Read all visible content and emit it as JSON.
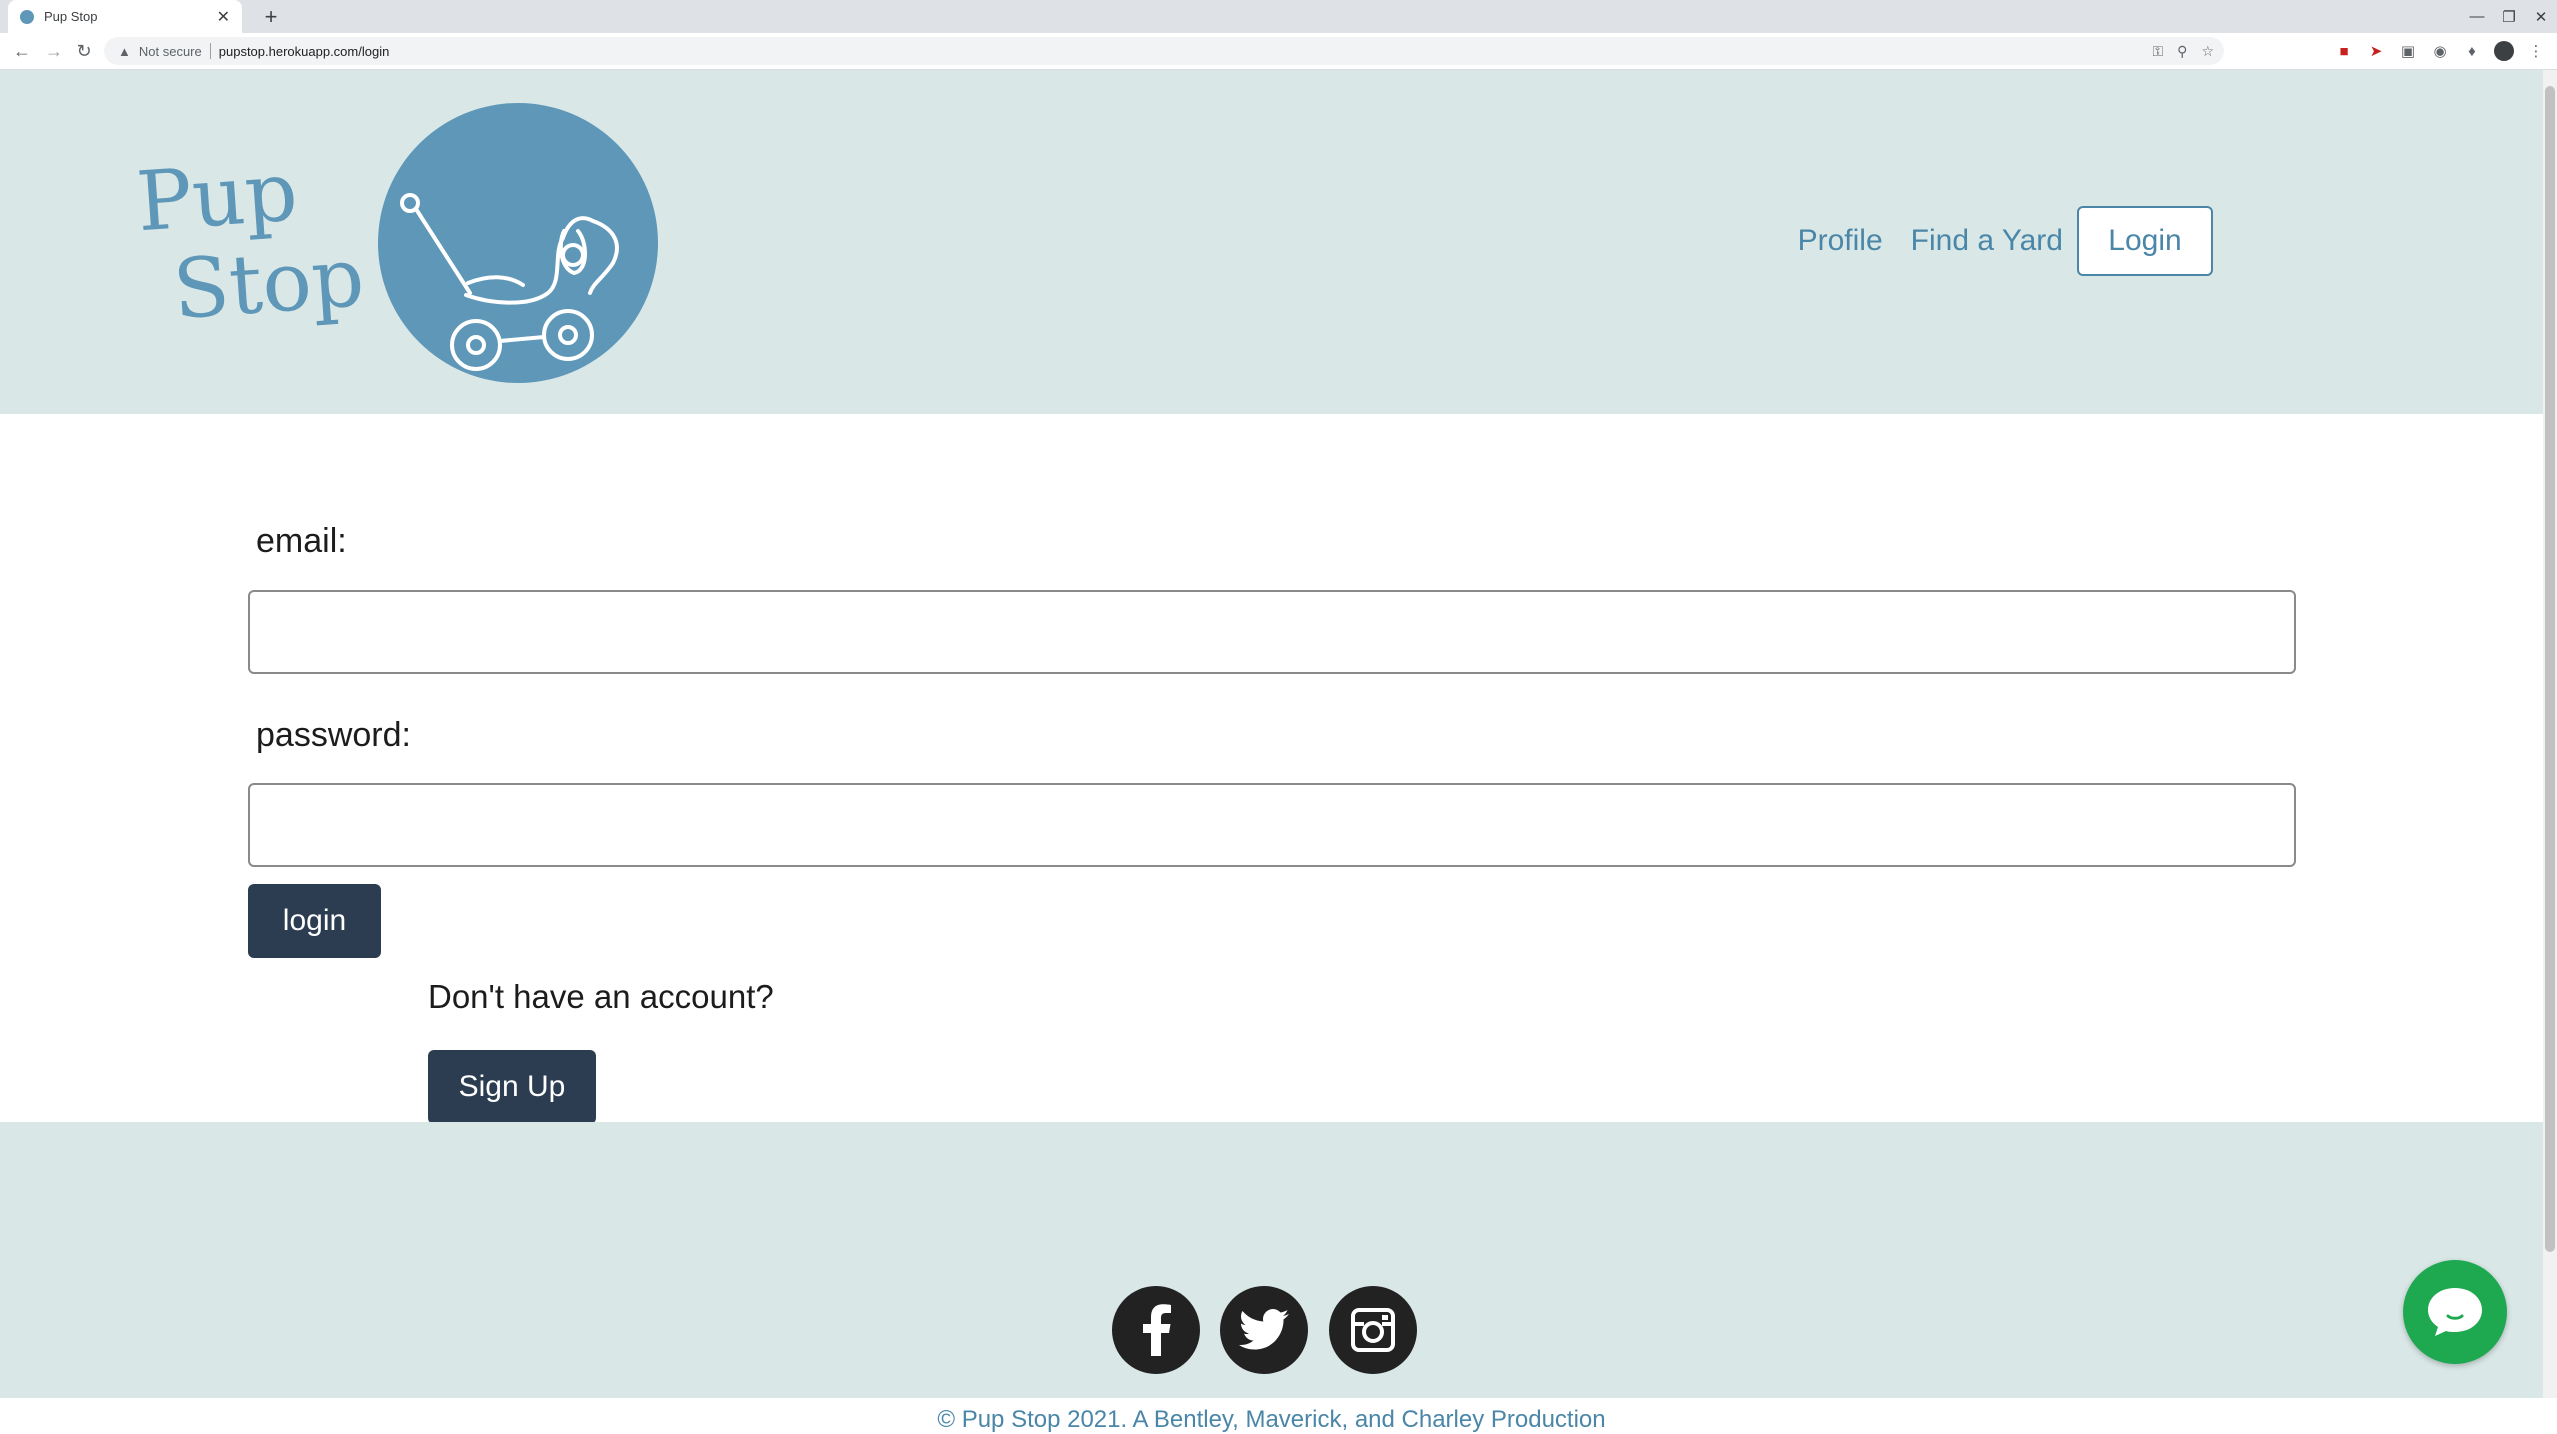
{
  "browser": {
    "tab_title": "Pup Stop",
    "tab_close": "✕",
    "new_tab": "+",
    "security_label": "Not secure",
    "url": "pupstop.herokuapp.com/login",
    "window_controls": {
      "minimize": "—",
      "restore": "❐",
      "close": "✕"
    }
  },
  "header": {
    "logo_line1": "Pup",
    "logo_line2": "Stop",
    "nav": {
      "profile": "Profile",
      "find_yard": "Find a Yard",
      "login": "Login"
    }
  },
  "form": {
    "email_label": "email:",
    "email_value": "",
    "password_label": "password:",
    "password_value": "",
    "login_button": "login",
    "no_account_text": "Don't have an account?",
    "signup_button": "Sign Up"
  },
  "footer": {
    "social": [
      "facebook-icon",
      "twitter-icon",
      "instagram-icon"
    ],
    "copyright": "© Pup Stop 2021. A Bentley, Maverick, and Charley Production"
  },
  "colors": {
    "header_bg": "#d9e8e7",
    "brand_blue": "#5e97b8",
    "link_blue": "#4a86a8",
    "button_dark": "#2c3d52",
    "chat_green": "#1ea84f"
  }
}
